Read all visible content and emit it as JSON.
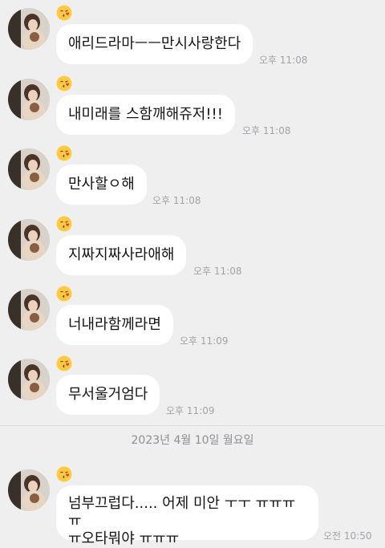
{
  "messages": [
    {
      "text": "애리드라마ㅡㅡ만시사랑한다",
      "time": "오후 11:08"
    },
    {
      "text": "내미래를 스함깨해쥬저!!!",
      "time": "오후 11:08"
    },
    {
      "text": "만사할ㅇ해",
      "time": "오후 11:08"
    },
    {
      "text": "지짜지짜사라애해",
      "time": "오후 11:08"
    },
    {
      "text": "너내라함께라면",
      "time": "오후 11:09"
    },
    {
      "text": "무서울거엄다",
      "time": "오후 11:09"
    }
  ],
  "date_divider": "2023년 4월 10일 월요일",
  "last_message": {
    "line1": "넘부끄럽다..... 어제 미안 ㅜㅜ ㅠㅠㅠㅠ",
    "line2": "ㅠ오타뭐야 ㅠㅠㅠ",
    "time": "오전 10:50"
  },
  "icons": {
    "reaction": "kissing-face-emoji",
    "avatar": "profile-photo"
  },
  "colors": {
    "background": "#efeff0",
    "bubble": "#ffffff",
    "timestamp": "#a3a3a6"
  }
}
